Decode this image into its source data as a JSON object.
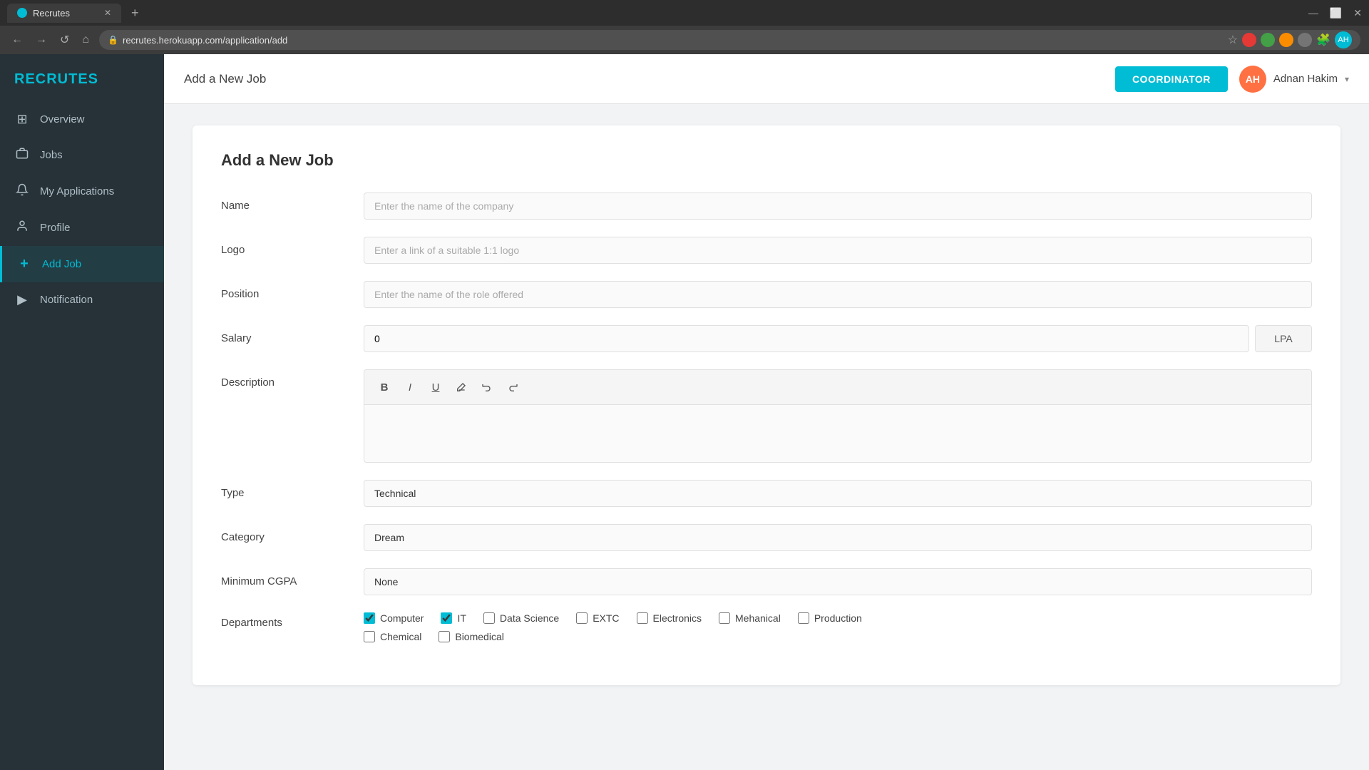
{
  "browser": {
    "tab_label": "Recrutes",
    "url": "recrutes.herokuapp.com/application/add",
    "new_tab_icon": "+",
    "nav_back": "←",
    "nav_forward": "→",
    "nav_refresh": "↺",
    "nav_home": "⌂"
  },
  "topbar": {
    "breadcrumb": "Add a New Job",
    "coordinator_btn": "COORDINATOR",
    "user_name": "Adnan Hakim",
    "user_initials": "AH"
  },
  "sidebar": {
    "logo": "RECRUTES",
    "items": [
      {
        "id": "overview",
        "label": "Overview",
        "icon": "⊞"
      },
      {
        "id": "jobs",
        "label": "Jobs",
        "icon": "💼"
      },
      {
        "id": "my-applications",
        "label": "My Applications",
        "icon": "🔔"
      },
      {
        "id": "profile",
        "label": "Profile",
        "icon": "👤"
      },
      {
        "id": "add-job",
        "label": "Add Job",
        "icon": "+"
      },
      {
        "id": "notification",
        "label": "Notification",
        "icon": "▶"
      }
    ]
  },
  "form": {
    "title": "Add a New Job",
    "fields": {
      "name_label": "Name",
      "name_placeholder": "Enter the name of the company",
      "logo_label": "Logo",
      "logo_placeholder": "Enter a link of a suitable 1:1 logo",
      "position_label": "Position",
      "position_placeholder": "Enter the name of the role offered",
      "salary_label": "Salary",
      "salary_value": "0",
      "salary_unit": "LPA",
      "description_label": "Description",
      "type_label": "Type",
      "type_value": "Technical",
      "category_label": "Category",
      "category_value": "Dream",
      "min_cgpa_label": "Minimum CGPA",
      "min_cgpa_value": "None",
      "departments_label": "Departments"
    },
    "toolbar": {
      "bold": "B",
      "italic": "I",
      "underline": "U",
      "erase": "◉",
      "undo": "↩",
      "redo": "↪"
    },
    "departments": [
      {
        "id": "computer",
        "label": "Computer",
        "checked": true
      },
      {
        "id": "it",
        "label": "IT",
        "checked": true
      },
      {
        "id": "data-science",
        "label": "Data Science",
        "checked": false
      },
      {
        "id": "extc",
        "label": "EXTC",
        "checked": false
      },
      {
        "id": "electronics",
        "label": "Electronics",
        "checked": false
      },
      {
        "id": "mehanical",
        "label": "Mehanical",
        "checked": false
      },
      {
        "id": "production",
        "label": "Production",
        "checked": false
      },
      {
        "id": "chemical",
        "label": "Chemical",
        "checked": false
      },
      {
        "id": "biomedical",
        "label": "Biomedical",
        "checked": false
      }
    ]
  }
}
